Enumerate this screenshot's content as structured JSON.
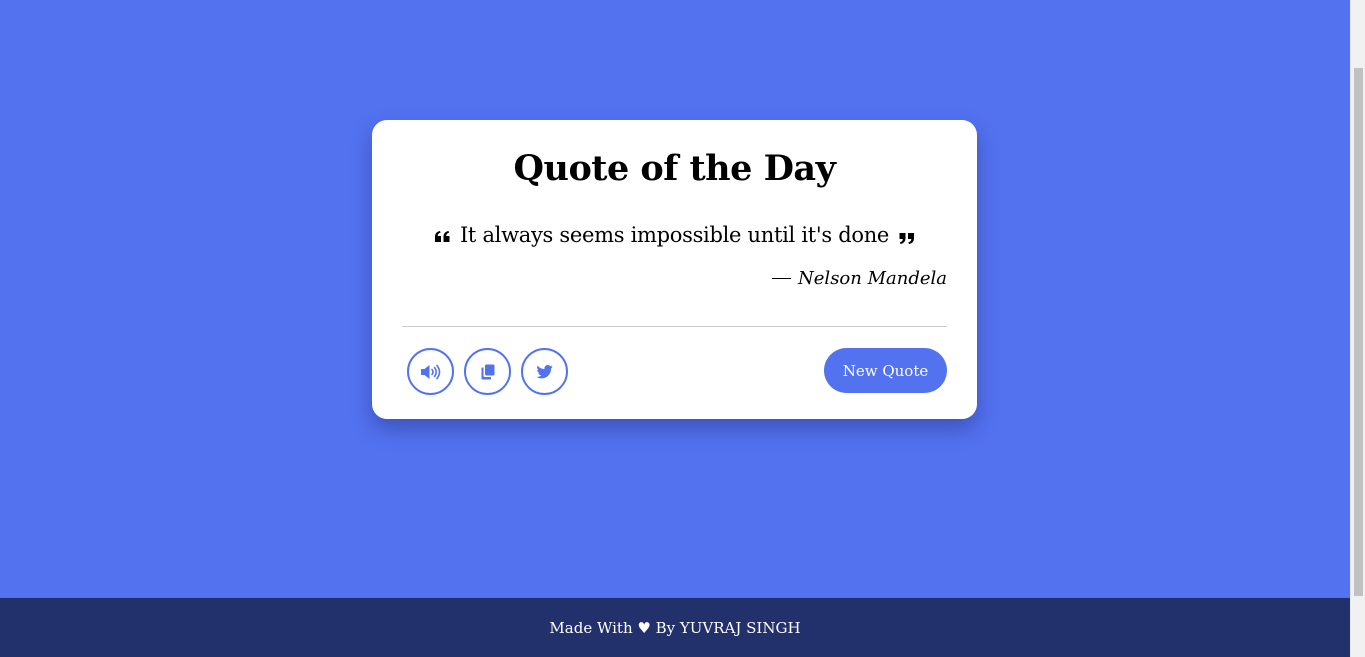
{
  "card": {
    "title": "Quote of the Day",
    "quote": "It always seems impossible until it's done",
    "author": "Nelson Mandela",
    "new_quote_label": "New Quote"
  },
  "buttons": {
    "speech_icon": "volume-icon",
    "copy_icon": "copy-icon",
    "twitter_icon": "twitter-icon"
  },
  "footer": {
    "prefix": "Made With ",
    "heart": "♥",
    "suffix": " By YUVRAJ SINGH"
  },
  "colors": {
    "background": "#5372f0",
    "accent": "#5372f0",
    "footer": "#22316b",
    "card": "#ffffff"
  }
}
